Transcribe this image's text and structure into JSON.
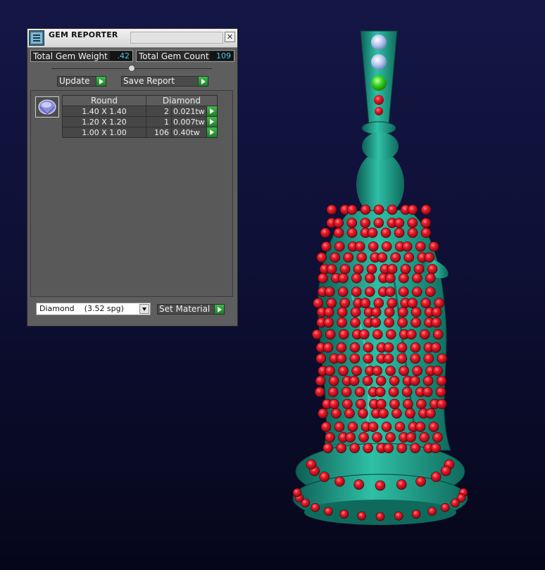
{
  "window": {
    "title": "GEM REPORTER",
    "close_glyph": "✕"
  },
  "totals": {
    "weight_label": "Total Gem Weight",
    "weight_value": ".42",
    "count_label": "Total Gem Count",
    "count_value": "109"
  },
  "buttons": {
    "update": "Update",
    "save_report": "Save Report",
    "set_material": "Set Material"
  },
  "report": {
    "header": {
      "shape": "Round",
      "material": "Diamond"
    },
    "rows": [
      {
        "size": "1.40 X 1.40",
        "count": "2",
        "weight": "0.021tw"
      },
      {
        "size": "1.20 X 1.20",
        "count": "1",
        "weight": "0.007tw"
      },
      {
        "size": "1.00 X 1.00",
        "count": "106",
        "weight": "0.40tw"
      }
    ]
  },
  "material_select": {
    "value": "Diamond    (3.52 spg)"
  },
  "icons": {
    "title": "gem-reporter-app-icon",
    "gem": "round-gem-icon",
    "go": "play-arrow-icon",
    "dropdown": "chevron-down-icon"
  },
  "colors": {
    "background": "#0e1036",
    "panel": "#5e5e5e",
    "metal": "#1fa08a",
    "ruby": "#e0152a",
    "accent_green": "#2aa33a",
    "value_text": "#4ac8e6"
  }
}
